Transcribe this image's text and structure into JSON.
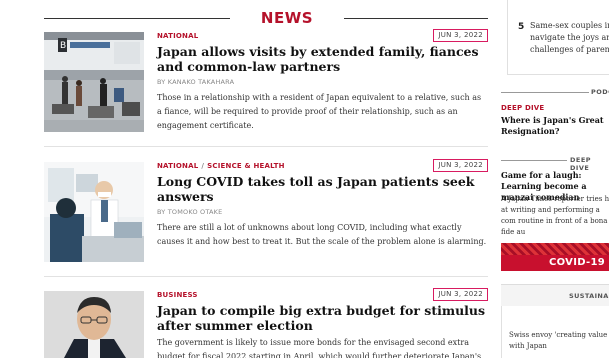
{
  "section_title": "NEWS",
  "articles": [
    {
      "categories": [
        "NATIONAL"
      ],
      "date": "JUN 3, 2022",
      "headline": "Japan allows visits by extended family, fiances and common-law partners",
      "byline": "BY KANAKO TAKAHARA",
      "summary": "Those in a relationship with a resident of Japan equivalent to a relative, such as a fiance, will be required to provide proof of their relationship, such as an engagement certificate.",
      "image": "airport-arrival-hall-photo"
    },
    {
      "categories": [
        "NATIONAL",
        "SCIENCE & HEALTH"
      ],
      "category_separator": "/",
      "date": "JUN 3, 2022",
      "headline": "Long COVID takes toll as Japan patients seek answers",
      "byline": "BY TOMOKO OTAKE",
      "summary": "There are still a lot of unknowns about long COVID, including what exactly causes it and how best to treat it. But the scale of the problem alone is alarming.",
      "image": "doctor-consultation-photo"
    },
    {
      "categories": [
        "BUSINESS"
      ],
      "date": "JUN 3, 2022",
      "headline": "Japan to compile big extra budget for stimulus after summer election",
      "byline": "",
      "summary": "The government is likely to issue more bonds for the envisaged second extra budget for fiscal 2022 starting in April, which would further deteriorate Japan's",
      "image": "prime-minister-portrait-photo"
    }
  ],
  "sidebar": {
    "ranked_item": {
      "rank": "5",
      "text": "Same-sex couples in navigate the joys an challenges of paren"
    },
    "podcast_label": "PODC",
    "deep_dive_category": "DEEP DIVE",
    "deep_dive_headline": "Where is Japan's Great Resignation?",
    "deep_dive_section_label": "DEEP DIVE",
    "feature_headline": "Game for a laugh: Learning become a manzai comedian",
    "feature_summary": "A Japan Times reporter tries his at writing and performing a com routine in front of a bona fide au",
    "covid_banner_label": "COVID-19",
    "sustainable_label": "SUSTAINAB",
    "sustainable_text": "Swiss envoy 'creating value to with Japan"
  },
  "colors": {
    "accent": "#b5122b",
    "date_outline": "#d81b60"
  }
}
